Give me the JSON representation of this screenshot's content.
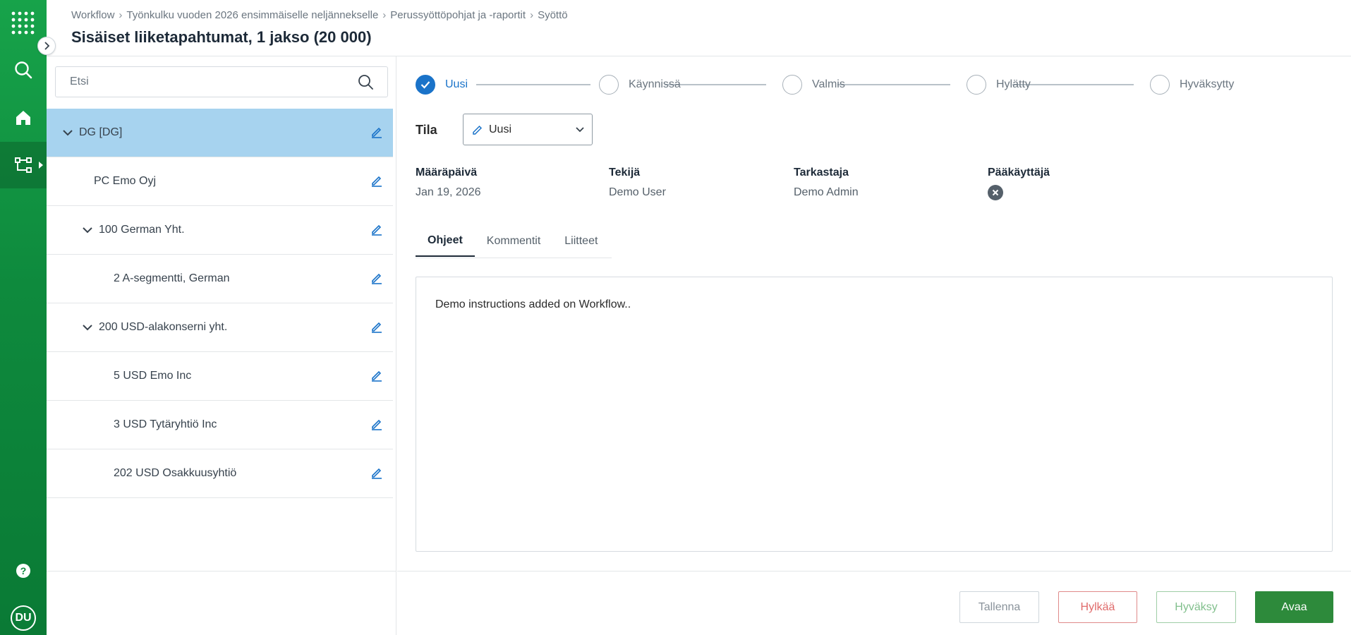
{
  "breadcrumb": [
    "Workflow",
    "Työnkulku vuoden 2026 ensimmäiselle neljännekselle",
    "Perussyöttöpohjat ja -raportit",
    "Syöttö"
  ],
  "breadcrumb_sep": "›",
  "page_title": "Sisäiset liiketapahtumat, 1 jakso (20 000)",
  "user_initials": "DU",
  "search": {
    "placeholder": "Etsi"
  },
  "tree": [
    {
      "label": "DG [DG]",
      "indent": 0,
      "expandable": true,
      "selected": true
    },
    {
      "label": "PC Emo Oyj",
      "indent": 1,
      "expandable": false,
      "selected": false
    },
    {
      "label": "100 German Yht.",
      "indent": 1,
      "expandable": true,
      "selected": false
    },
    {
      "label": "2 A-segmentti, German",
      "indent": 2,
      "expandable": false,
      "selected": false
    },
    {
      "label": "200 USD-alakonserni yht.",
      "indent": 1,
      "expandable": true,
      "selected": false
    },
    {
      "label": "5 USD Emo Inc",
      "indent": 2,
      "expandable": false,
      "selected": false
    },
    {
      "label": "3 USD Tytäryhtiö Inc",
      "indent": 2,
      "expandable": false,
      "selected": false
    },
    {
      "label": "202 USD Osakkuusyhtiö",
      "indent": 2,
      "expandable": false,
      "selected": false
    }
  ],
  "stepper": [
    {
      "label": "Uusi",
      "done": true
    },
    {
      "label": "Käynnissä",
      "done": false
    },
    {
      "label": "Valmis",
      "done": false
    },
    {
      "label": "Hylätty",
      "done": false
    },
    {
      "label": "Hyväksytty",
      "done": false
    }
  ],
  "status": {
    "label": "Tila",
    "value": "Uusi"
  },
  "meta": {
    "due_date_label": "Määräpäivä",
    "due_date": "Jan 19, 2026",
    "author_label": "Tekijä",
    "author": "Demo User",
    "reviewer_label": "Tarkastaja",
    "reviewer": "Demo Admin",
    "admin_label": "Pääkäyttäjä"
  },
  "tabs": [
    {
      "label": "Ohjeet",
      "active": true
    },
    {
      "label": "Kommentit",
      "active": false
    },
    {
      "label": "Liitteet",
      "active": false
    }
  ],
  "instructions_text": "Demo instructions added on Workflow..",
  "buttons": {
    "save": "Tallenna",
    "reject": "Hylkää",
    "approve": "Hyväksy",
    "open": "Avaa"
  },
  "colors": {
    "rail_green": "#0e8a3d",
    "selected_row": "#a7d3ef",
    "accent_blue": "#1a73c9",
    "primary_button": "#2d8a3b"
  }
}
